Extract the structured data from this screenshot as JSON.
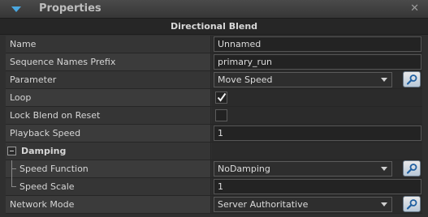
{
  "panel": {
    "title": "Properties",
    "close_glyph": "✕"
  },
  "section": {
    "title": "Directional Blend"
  },
  "properties": {
    "name": {
      "label": "Name",
      "value": "Unnamed"
    },
    "sequence_prefix": {
      "label": "Sequence Names Prefix",
      "value": "primary_run"
    },
    "parameter": {
      "label": "Parameter",
      "value": "Move Speed"
    },
    "loop": {
      "label": "Loop",
      "checked": true
    },
    "lock_blend": {
      "label": "Lock Blend on Reset",
      "checked": false
    },
    "playback_speed": {
      "label": "Playback Speed",
      "value": "1"
    },
    "damping_group": {
      "label": "Damping"
    },
    "speed_function": {
      "label": "Speed Function",
      "value": "NoDamping"
    },
    "speed_scale": {
      "label": "Speed Scale",
      "value": "1"
    },
    "network_mode": {
      "label": "Network Mode",
      "value": "Server Authoritative"
    }
  },
  "colors": {
    "accent": "#4aa7e0",
    "panel_bg": "#2f2f2f"
  }
}
